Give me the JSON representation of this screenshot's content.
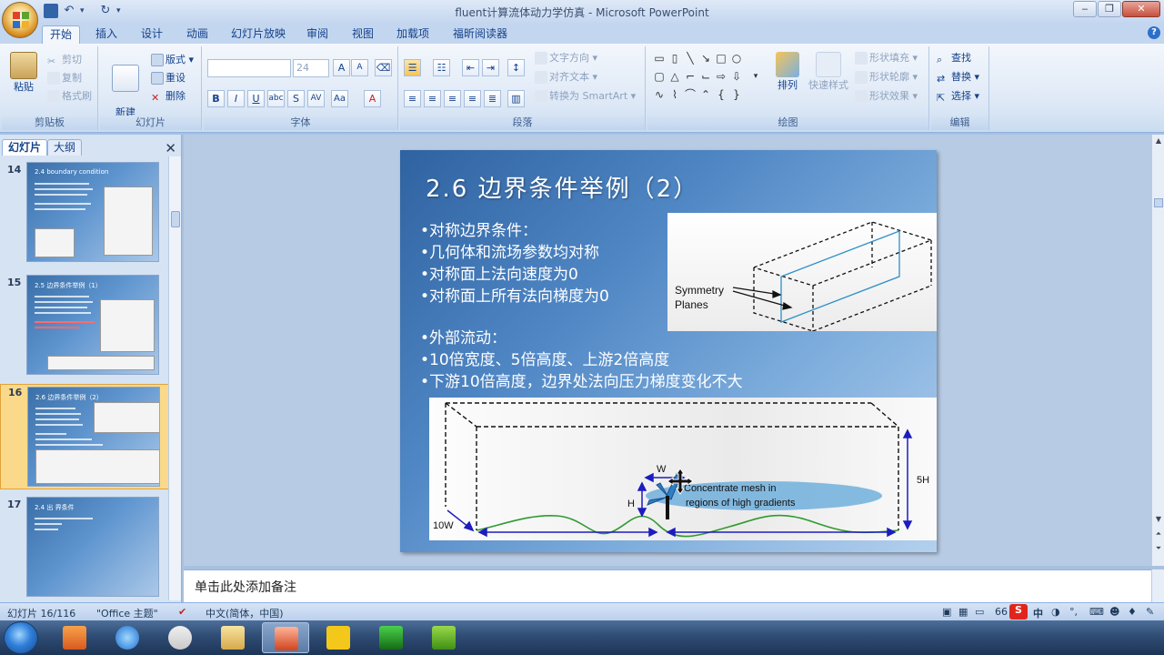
{
  "window": {
    "title": "fluent计算流体动力学仿真 - Microsoft PowerPoint"
  },
  "ribbon_tabs": [
    {
      "label": "开始",
      "active": true
    },
    {
      "label": "插入"
    },
    {
      "label": "设计"
    },
    {
      "label": "动画"
    },
    {
      "label": "幻灯片放映"
    },
    {
      "label": "审阅"
    },
    {
      "label": "视图"
    },
    {
      "label": "加载项"
    },
    {
      "label": "福昕阅读器"
    }
  ],
  "ribbon": {
    "clipboard": {
      "label": "剪贴板",
      "paste": "粘贴",
      "cut": "剪切",
      "copy": "复制",
      "format_painter": "格式刷"
    },
    "slides": {
      "label": "幻灯片",
      "new_slide": "新建\n幻灯片",
      "layout": "版式",
      "reset": "重设",
      "delete": "删除"
    },
    "font": {
      "label": "字体",
      "font_size": "24",
      "font_name": ""
    },
    "paragraph": {
      "label": "段落",
      "text_direction": "文字方向",
      "align_text": "对齐文本",
      "smartart": "转换为 SmartArt"
    },
    "drawing": {
      "label": "绘图",
      "arrange": "排列",
      "quick_styles": "快速样式",
      "shape_fill": "形状填充",
      "shape_outline": "形状轮廓",
      "shape_effects": "形状效果"
    },
    "editing": {
      "label": "编辑",
      "find": "查找",
      "replace": "替换",
      "select": "选择"
    }
  },
  "panel": {
    "tab_slides": "幻灯片",
    "tab_outline": "大纲",
    "thumbnails": [
      {
        "num": "14",
        "title": "2.4 boundary condition"
      },
      {
        "num": "15",
        "title": "2.5 边界条件举例（1）"
      },
      {
        "num": "16",
        "title": "2.6 边界条件举例（2）",
        "selected": true
      },
      {
        "num": "17",
        "title": "2.4 出 界条件"
      }
    ]
  },
  "slide": {
    "title": "2.6 边界条件举例（2）",
    "bullets_1": [
      "•对称边界条件：",
      "•几何体和流场参数均对称",
      "•对称面上法向速度为0",
      "•对称面上所有法向梯度为0"
    ],
    "bullets_2": [
      "•外部流动：",
      "•10倍宽度、5倍高度、上游2倍高度",
      "•下游10倍高度，边界处法向压力梯度变化不大"
    ],
    "fig1": {
      "label_line1": "Symmetry",
      "label_line2": "Planes"
    },
    "fig2": {
      "w": "W",
      "h": "H",
      "height5": "5H",
      "width10": "10W",
      "mesh_line1": "Concentrate mesh in",
      "mesh_line2": "regions of high gradients"
    }
  },
  "notes": {
    "placeholder": "单击此处添加备注"
  },
  "status": {
    "slide_counter": "幻灯片 16/116",
    "theme": "\"Office 主题\"",
    "language": "中文(简体，中国)",
    "zoom": "66"
  },
  "colors": {
    "accent": "#15428b",
    "slide_blue": "#3f78b8",
    "ime_red": "#e0261c"
  }
}
